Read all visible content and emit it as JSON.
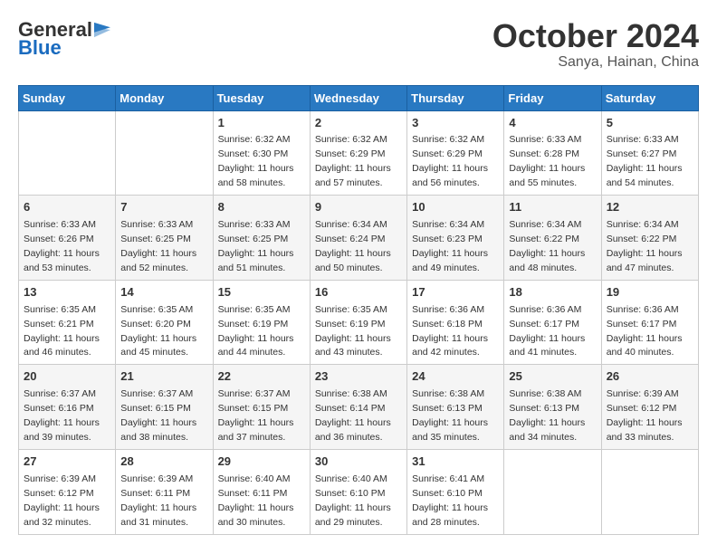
{
  "logo": {
    "general": "General",
    "blue": "Blue"
  },
  "title": "October 2024",
  "subtitle": "Sanya, Hainan, China",
  "weekdays": [
    "Sunday",
    "Monday",
    "Tuesday",
    "Wednesday",
    "Thursday",
    "Friday",
    "Saturday"
  ],
  "weeks": [
    [
      null,
      null,
      {
        "day": 1,
        "sunrise": "6:32 AM",
        "sunset": "6:30 PM",
        "daylight": "11 hours and 58 minutes."
      },
      {
        "day": 2,
        "sunrise": "6:32 AM",
        "sunset": "6:29 PM",
        "daylight": "11 hours and 57 minutes."
      },
      {
        "day": 3,
        "sunrise": "6:32 AM",
        "sunset": "6:29 PM",
        "daylight": "11 hours and 56 minutes."
      },
      {
        "day": 4,
        "sunrise": "6:33 AM",
        "sunset": "6:28 PM",
        "daylight": "11 hours and 55 minutes."
      },
      {
        "day": 5,
        "sunrise": "6:33 AM",
        "sunset": "6:27 PM",
        "daylight": "11 hours and 54 minutes."
      }
    ],
    [
      {
        "day": 6,
        "sunrise": "6:33 AM",
        "sunset": "6:26 PM",
        "daylight": "11 hours and 53 minutes."
      },
      {
        "day": 7,
        "sunrise": "6:33 AM",
        "sunset": "6:25 PM",
        "daylight": "11 hours and 52 minutes."
      },
      {
        "day": 8,
        "sunrise": "6:33 AM",
        "sunset": "6:25 PM",
        "daylight": "11 hours and 51 minutes."
      },
      {
        "day": 9,
        "sunrise": "6:34 AM",
        "sunset": "6:24 PM",
        "daylight": "11 hours and 50 minutes."
      },
      {
        "day": 10,
        "sunrise": "6:34 AM",
        "sunset": "6:23 PM",
        "daylight": "11 hours and 49 minutes."
      },
      {
        "day": 11,
        "sunrise": "6:34 AM",
        "sunset": "6:22 PM",
        "daylight": "11 hours and 48 minutes."
      },
      {
        "day": 12,
        "sunrise": "6:34 AM",
        "sunset": "6:22 PM",
        "daylight": "11 hours and 47 minutes."
      }
    ],
    [
      {
        "day": 13,
        "sunrise": "6:35 AM",
        "sunset": "6:21 PM",
        "daylight": "11 hours and 46 minutes."
      },
      {
        "day": 14,
        "sunrise": "6:35 AM",
        "sunset": "6:20 PM",
        "daylight": "11 hours and 45 minutes."
      },
      {
        "day": 15,
        "sunrise": "6:35 AM",
        "sunset": "6:19 PM",
        "daylight": "11 hours and 44 minutes."
      },
      {
        "day": 16,
        "sunrise": "6:35 AM",
        "sunset": "6:19 PM",
        "daylight": "11 hours and 43 minutes."
      },
      {
        "day": 17,
        "sunrise": "6:36 AM",
        "sunset": "6:18 PM",
        "daylight": "11 hours and 42 minutes."
      },
      {
        "day": 18,
        "sunrise": "6:36 AM",
        "sunset": "6:17 PM",
        "daylight": "11 hours and 41 minutes."
      },
      {
        "day": 19,
        "sunrise": "6:36 AM",
        "sunset": "6:17 PM",
        "daylight": "11 hours and 40 minutes."
      }
    ],
    [
      {
        "day": 20,
        "sunrise": "6:37 AM",
        "sunset": "6:16 PM",
        "daylight": "11 hours and 39 minutes."
      },
      {
        "day": 21,
        "sunrise": "6:37 AM",
        "sunset": "6:15 PM",
        "daylight": "11 hours and 38 minutes."
      },
      {
        "day": 22,
        "sunrise": "6:37 AM",
        "sunset": "6:15 PM",
        "daylight": "11 hours and 37 minutes."
      },
      {
        "day": 23,
        "sunrise": "6:38 AM",
        "sunset": "6:14 PM",
        "daylight": "11 hours and 36 minutes."
      },
      {
        "day": 24,
        "sunrise": "6:38 AM",
        "sunset": "6:13 PM",
        "daylight": "11 hours and 35 minutes."
      },
      {
        "day": 25,
        "sunrise": "6:38 AM",
        "sunset": "6:13 PM",
        "daylight": "11 hours and 34 minutes."
      },
      {
        "day": 26,
        "sunrise": "6:39 AM",
        "sunset": "6:12 PM",
        "daylight": "11 hours and 33 minutes."
      }
    ],
    [
      {
        "day": 27,
        "sunrise": "6:39 AM",
        "sunset": "6:12 PM",
        "daylight": "11 hours and 32 minutes."
      },
      {
        "day": 28,
        "sunrise": "6:39 AM",
        "sunset": "6:11 PM",
        "daylight": "11 hours and 31 minutes."
      },
      {
        "day": 29,
        "sunrise": "6:40 AM",
        "sunset": "6:11 PM",
        "daylight": "11 hours and 30 minutes."
      },
      {
        "day": 30,
        "sunrise": "6:40 AM",
        "sunset": "6:10 PM",
        "daylight": "11 hours and 29 minutes."
      },
      {
        "day": 31,
        "sunrise": "6:41 AM",
        "sunset": "6:10 PM",
        "daylight": "11 hours and 28 minutes."
      },
      null,
      null
    ]
  ]
}
